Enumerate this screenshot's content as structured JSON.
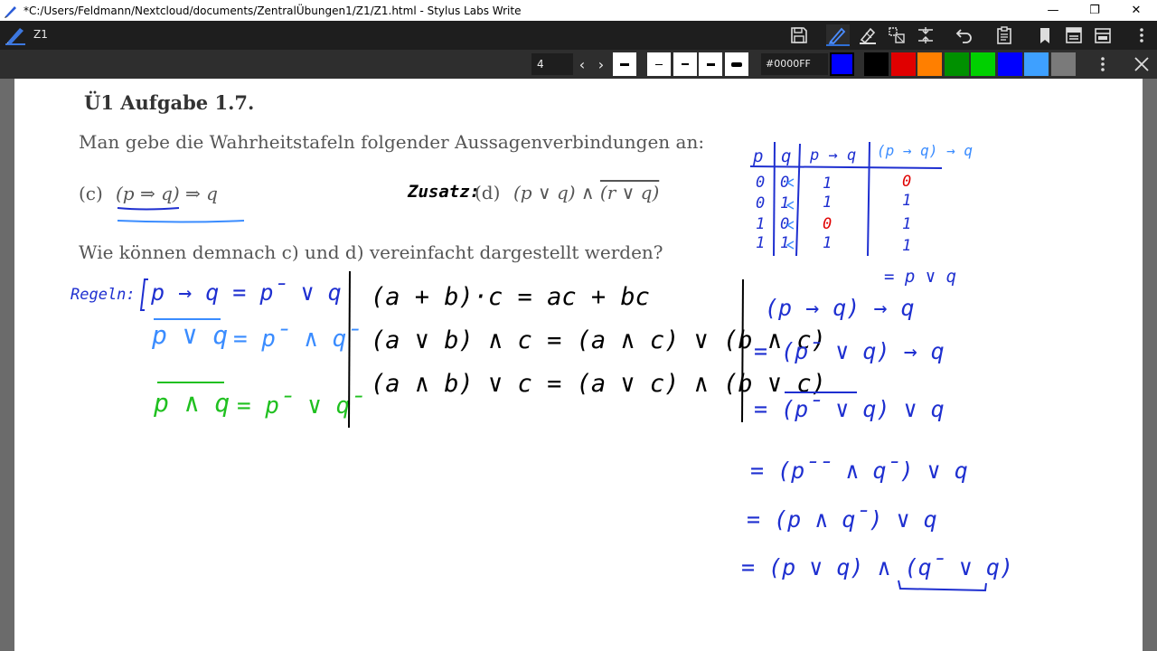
{
  "window": {
    "title": "*C:/Users/Feldmann/Nextcloud/documents/ZentralÜbungen1/Z1/Z1.html - Stylus Labs Write",
    "minimize": "—",
    "maximize": "❐",
    "close": "✕"
  },
  "toolbar": {
    "doc_name": "Z1",
    "icons": [
      "save-icon",
      "pen-icon",
      "highlighter-icon",
      "select-icon",
      "insert-space-icon",
      "undo-icon",
      "clipboard-icon",
      "bookmark-icon",
      "document-icon",
      "layout-icon",
      "more-icon"
    ]
  },
  "pen": {
    "width_value": "4",
    "prev": "‹",
    "next": "›",
    "color_value": "#0000FF",
    "swatches": [
      "#000000",
      "#e00000",
      "#ff7f00",
      "#009000",
      "#00d000",
      "#0000ff",
      "#3ea0ff",
      "#7a7a7a"
    ],
    "selected_color": "#0000ff"
  },
  "document": {
    "heading": "Ü1  Aufgabe 1.7.",
    "intro": "Man gebe die Wahrheitstafeln folgender Aussagenverbindungen an:",
    "part_c_label": "(c)",
    "part_c_formula": "(p ⇒ q) ⇒ q",
    "part_d_label": "(d)",
    "part_d_formula": "(p ∨ q) ∧ ",
    "part_d_overline": "(r ∨ q)",
    "question": "Wie können demnach c) und d) vereinfacht dargestellt werden?"
  },
  "handwriting": {
    "zusatz": "Zusatz:",
    "regeln": "Regeln:",
    "rule1": "p → q = p̄ ∨ q",
    "rule2_left": "p ∨ q",
    "rule2_right": "= p̄ ∧ q̄",
    "rule3_left": "p ∧ q",
    "rule3_right": "= p̄ ∨ q̄",
    "dist1": "(a + b)·c = ac + bc",
    "dist2": "(a ∨ b) ∧ c = (a ∧ c) ∨ (b ∧ c)",
    "dist3": "(a ∧ b) ∨ c = (a ∨ c) ∧ (b ∨ c)",
    "table_header": [
      "p",
      "q",
      "p → q",
      "(p → q) → q"
    ],
    "table_rows": [
      [
        "0",
        "0",
        "1",
        "0"
      ],
      [
        "0",
        "1",
        "1",
        "1"
      ],
      [
        "1",
        "0",
        "0",
        "1"
      ],
      [
        "1",
        "1",
        "1",
        "1"
      ]
    ],
    "table_result": "= p ∨ q",
    "derivation": [
      "(p → q) → q",
      "= (p̄ ∨ q) → q",
      "= (p̄ ∨ q) ∨ q",
      "= (p̄̄ ∧ q̄) ∨ q",
      "= (p ∧ q̄) ∨ q",
      "= (p ∨ q) ∧ (q̄ ∨ q)"
    ]
  }
}
